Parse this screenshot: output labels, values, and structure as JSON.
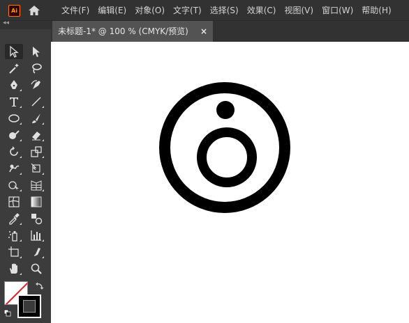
{
  "app": {
    "logo_text": "Ai",
    "accent": "#ff9a00"
  },
  "menu": {
    "items": [
      "文件(F)",
      "编辑(E)",
      "对象(O)",
      "文字(T)",
      "选择(S)",
      "效果(C)",
      "视图(V)",
      "窗口(W)",
      "帮助(H)"
    ]
  },
  "toolbar": {
    "collapse_glyph": "◂◂"
  },
  "document": {
    "tab_title": "未标题-1* @ 100 % (CMYK/预览)",
    "close_glyph": "×"
  },
  "tools": [
    "selection-tool-icon",
    "direct-selection-tool-icon",
    "magic-wand-icon",
    "lasso-icon",
    "pen-tool-icon",
    "curvature-tool-icon",
    "type-tool-icon",
    "line-segment-tool-icon",
    "ellipse-tool-icon",
    "paintbrush-icon",
    "shaper-tool-icon",
    "eraser-icon",
    "rotate-tool-icon",
    "scale-tool-icon",
    "warp-tool-icon",
    "free-transform-icon",
    "shape-builder-icon",
    "perspective-grid-icon",
    "mesh-tool-icon",
    "gradient-tool-icon",
    "eyedropper-icon",
    "blend-tool-icon",
    "symbol-sprayer-icon",
    "column-graph-icon",
    "artboard-tool-icon",
    "slice-tool-icon",
    "hand-tool-icon",
    "zoom-tool-icon"
  ],
  "colors": {
    "fill": "none",
    "stroke": "#000000"
  }
}
